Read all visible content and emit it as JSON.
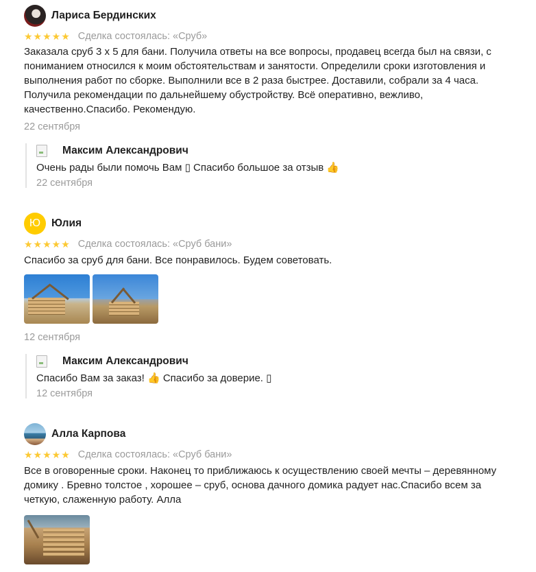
{
  "reviews": [
    {
      "author": "Лариса Бердинских",
      "stars": "★★★★★",
      "deal": "Сделка состоялась: «Сруб»",
      "text": "Заказала сруб 3 х 5 для бани. Получила ответы на все вопросы, продавец всегда был на связи, с пониманием относился к моим обстоятельствам и занятости. Определили сроки изготовления и выполнения работ по сборке. Выполнили все в 2 раза быстрее. Доставили, собрали за 4 часа. Получила рекомендации по дальнейшему обустройству. Всё оперативно, вежливо, качественно.Спасибо. Рекомендую.",
      "date": "22 сентября",
      "reply": {
        "author": "Максим Александрович",
        "text": "Очень рады были помочь Вам ▯ Спасибо большое за отзыв 👍",
        "date": "22 сентября"
      }
    },
    {
      "author": "Юлия",
      "avatar_letter": "Ю",
      "stars": "★★★★★",
      "deal": "Сделка состоялась: «Сруб бани»",
      "text": "Спасибо за сруб для бани. Все понравилось. Будем советовать.",
      "date": "12 сентября",
      "reply": {
        "author": "Максим Александрович",
        "text": "Спасибо Вам за заказ! 👍 Спасибо за доверие. ▯",
        "date": "12 сентября"
      }
    },
    {
      "author": "Алла Карпова",
      "stars": "★★★★★",
      "deal": "Сделка состоялась: «Сруб бани»",
      "text": "Все в оговоренные сроки. Наконец то приближаюсь к осуществлению своей мечты – деревянному домику . Бревно толстое , хорошее – сруб, основа дачного домика радует нас.Спасибо всем за четкую, слаженную работу. Алла"
    }
  ],
  "colors": {
    "star": "#fcc934",
    "muted": "#9a9a9a",
    "text": "#1f1f1f",
    "avatar_yellow": "#ffcc00"
  }
}
